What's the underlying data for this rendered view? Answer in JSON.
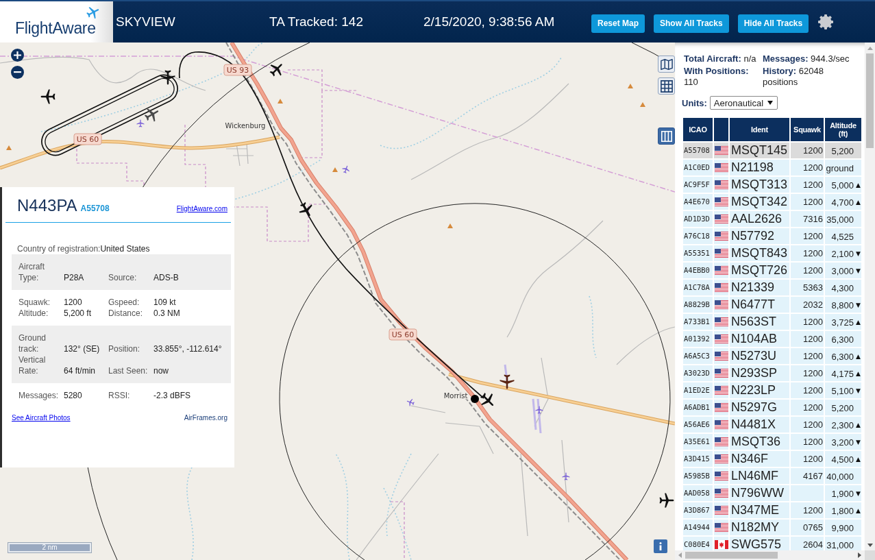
{
  "header": {
    "logo": "FlightAware",
    "title": "SKYVIEW",
    "tracked": "TA Tracked: 142",
    "datetime": "2/15/2020, 9:38:56 AM",
    "buttons": [
      "Reset Map",
      "Show All Tracks",
      "Hide All Tracks"
    ]
  },
  "map": {
    "labels": [
      {
        "text": "US 93",
        "kind": "road"
      },
      {
        "text": "Wickenburg",
        "kind": "town"
      },
      {
        "text": "US 60",
        "kind": "road"
      },
      {
        "text": "US 60",
        "kind": "road"
      },
      {
        "text": "Morrist",
        "kind": "town"
      }
    ],
    "scale": "2 nm"
  },
  "info_panel": {
    "registration": "N443PA",
    "icao": "A55708",
    "link": "FlightAware.com",
    "country_label": "Country of registration:",
    "country": "United States",
    "sections": [
      {
        "fields": [
          {
            "label": "Aircraft Type:",
            "value": "P28A"
          },
          {
            "label": "Source:",
            "value": "ADS-B"
          }
        ]
      },
      {
        "fields": [
          {
            "label": "Squawk:",
            "value": "1200"
          },
          {
            "label": "Gspeed:",
            "value": "109 kt"
          },
          {
            "label": "Altitude:",
            "value": "5,200 ft"
          },
          {
            "label": "Distance:",
            "value": "0.3 NM"
          }
        ]
      },
      {
        "fields": [
          {
            "label": "Ground track:",
            "value": "132° (SE)"
          },
          {
            "label": "Position:",
            "value": "33.855°, -112.614°"
          },
          {
            "label": "Vertical Rate:",
            "value": "64 ft/min"
          },
          {
            "label": "Last Seen:",
            "value": "now"
          }
        ]
      },
      {
        "fields": [
          {
            "label": "Messages:",
            "value": "5280"
          },
          {
            "label": "RSSI:",
            "value": "-2.3 dBFS"
          }
        ]
      }
    ],
    "links": [
      "See Aircraft Photos",
      "AirFrames.org"
    ]
  },
  "stats": [
    {
      "text": "**Total Aircraft:** n/a"
    },
    {
      "text": "**Messages:** 944.3/sec"
    },
    {
      "text": "**With Positions:** 110"
    },
    {
      "text": "**History:** 62048 positions"
    }
  ],
  "units": {
    "label": "Units:",
    "value": "Aeronautical"
  },
  "table": {
    "columns": [
      {
        "kind": "icao",
        "label": "ICAO"
      },
      {
        "kind": "flag"
      },
      {
        "kind": "ident",
        "label": "Ident"
      },
      {
        "kind": "squawk",
        "label": "Squawk"
      },
      {
        "kind": "altitude",
        "label": "Altitude (ft)"
      }
    ],
    "rows": [
      {
        "icao": "A55708",
        "flag": {
          "kind": "us"
        },
        "ident": "MSQT145",
        "squawk": "1200",
        "altitude": "5,200",
        "selected": true
      },
      {
        "icao": "A1C0ED",
        "flag": {
          "kind": "us"
        },
        "ident": "N21198",
        "squawk": "1200",
        "altitude": "ground",
        "selected": false
      },
      {
        "icao": "AC9F5F",
        "flag": {
          "kind": "us"
        },
        "ident": "MSQT313",
        "squawk": "1200",
        "altitude": "5,000",
        "trend": "▲",
        "selected": false
      },
      {
        "icao": "A4E670",
        "flag": {
          "kind": "us"
        },
        "ident": "MSQT342",
        "squawk": "1200",
        "altitude": "4,700",
        "trend": "▲",
        "selected": false
      },
      {
        "icao": "AD1D3D",
        "flag": {
          "kind": "us"
        },
        "ident": "AAL2626",
        "squawk": "7316",
        "altitude": "35,000",
        "selected": false
      },
      {
        "icao": "A76C18",
        "flag": {
          "kind": "us"
        },
        "ident": "N57792",
        "squawk": "1200",
        "altitude": "4,525",
        "selected": false
      },
      {
        "icao": "A55351",
        "flag": {
          "kind": "us"
        },
        "ident": "MSQT843",
        "squawk": "1200",
        "altitude": "2,100",
        "trend": "▼",
        "selected": false
      },
      {
        "icao": "A4EBB0",
        "flag": {
          "kind": "us"
        },
        "ident": "MSQT726",
        "squawk": "1200",
        "altitude": "3,000",
        "trend": "▼",
        "selected": false
      },
      {
        "icao": "A1C78A",
        "flag": {
          "kind": "us"
        },
        "ident": "N21339",
        "squawk": "5363",
        "altitude": "4,300",
        "selected": false
      },
      {
        "icao": "A8829B",
        "flag": {
          "kind": "us"
        },
        "ident": "N6477T",
        "squawk": "2032",
        "altitude": "8,800",
        "trend": "▼",
        "selected": false
      },
      {
        "icao": "A733B1",
        "flag": {
          "kind": "us"
        },
        "ident": "N563ST",
        "squawk": "1200",
        "altitude": "3,725",
        "trend": "▲",
        "selected": false
      },
      {
        "icao": "A01392",
        "flag": {
          "kind": "us"
        },
        "ident": "N104AB",
        "squawk": "1200",
        "altitude": "6,300",
        "selected": false
      },
      {
        "icao": "A6A5C3",
        "flag": {
          "kind": "us"
        },
        "ident": "N5273U",
        "squawk": "1200",
        "altitude": "6,300",
        "trend": "▲",
        "selected": false
      },
      {
        "icao": "A3023D",
        "flag": {
          "kind": "us"
        },
        "ident": "N293SP",
        "squawk": "1200",
        "altitude": "4,175",
        "trend": "▲",
        "selected": false
      },
      {
        "icao": "A1ED2E",
        "flag": {
          "kind": "us"
        },
        "ident": "N223LP",
        "squawk": "1200",
        "altitude": "5,100",
        "trend": "▼",
        "selected": false
      },
      {
        "icao": "A6ADB1",
        "flag": {
          "kind": "us"
        },
        "ident": "N5297G",
        "squawk": "1200",
        "altitude": "5,200",
        "selected": false
      },
      {
        "icao": "A56AE6",
        "flag": {
          "kind": "us"
        },
        "ident": "N4481X",
        "squawk": "1200",
        "altitude": "2,300",
        "trend": "▲",
        "selected": false
      },
      {
        "icao": "A35E61",
        "flag": {
          "kind": "us"
        },
        "ident": "MSQT36",
        "squawk": "1200",
        "altitude": "3,200",
        "trend": "▼",
        "selected": false
      },
      {
        "icao": "A3D415",
        "flag": {
          "kind": "us"
        },
        "ident": "N346F",
        "squawk": "1200",
        "altitude": "4,500",
        "trend": "▲",
        "selected": false
      },
      {
        "icao": "A5985B",
        "flag": {
          "kind": "us"
        },
        "ident": "LN46MF",
        "squawk": "4167",
        "altitude": "40,000",
        "selected": false
      },
      {
        "icao": "AAD058",
        "flag": {
          "kind": "us"
        },
        "ident": "N796WW",
        "altitude": "1,900",
        "trend": "▼",
        "selected": false
      },
      {
        "icao": "A3D867",
        "flag": {
          "kind": "us"
        },
        "ident": "N347ME",
        "squawk": "1200",
        "altitude": "1,800",
        "trend": "▲",
        "selected": false
      },
      {
        "icao": "A14944",
        "flag": {
          "kind": "us"
        },
        "ident": "N182MY",
        "squawk": "0765",
        "altitude": "9,900",
        "selected": false
      },
      {
        "icao": "C080E4",
        "flag": {
          "kind": "ca"
        },
        "ident": "SWG575",
        "squawk": "2604",
        "altitude": "31,000",
        "selected": false
      }
    ]
  }
}
